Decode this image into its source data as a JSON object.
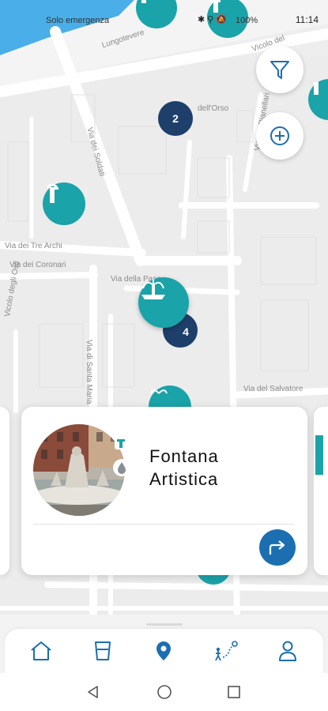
{
  "status_bar": {
    "carrier": "Solo emergenza",
    "battery": "100%",
    "time": "11:14"
  },
  "map": {
    "streets": [
      "Lungotevere",
      "Vicolo del",
      "Via dei Soldati",
      "dell'Orso",
      "Via dei Tre Archi",
      "Via dei Coronari",
      "Via della Pace",
      "Vicolo degli Osti",
      "Via di Santa Maria",
      "Via del Salvatore",
      "Via del Pianellari"
    ],
    "cluster_counts": [
      "2",
      "4"
    ]
  },
  "controls": {
    "filter_icon": "filter-icon",
    "add_icon": "add-location-icon"
  },
  "card": {
    "title": "Fontana Artistica",
    "badges": [
      "fountain-icon",
      "water-drop-icon"
    ],
    "directions_icon": "directions-arrow-icon"
  },
  "nav": {
    "items": [
      "home-icon",
      "glass-icon",
      "map-pin-icon",
      "route-icon",
      "profile-icon"
    ],
    "active": "map-pin-icon"
  },
  "colors": {
    "teal": "#1aa3a8",
    "navy": "#1d3f6a",
    "blue": "#1b6fb0",
    "river": "#4aaee8"
  }
}
